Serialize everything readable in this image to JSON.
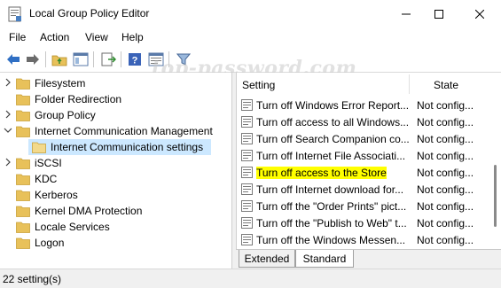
{
  "window": {
    "title": "Local Group Policy Editor",
    "icon": "policy-editor-icon",
    "controls": [
      "minimize",
      "maximize",
      "close"
    ]
  },
  "menu": [
    "File",
    "Action",
    "View",
    "Help"
  ],
  "toolbar": {
    "buttons": [
      "back-icon",
      "forward-icon",
      "up-folder-icon",
      "show-hide-tree-icon",
      "export-list-icon",
      "help-icon",
      "properties-icon",
      "filter-icon"
    ]
  },
  "tree": {
    "items": [
      {
        "label": "Filesystem",
        "expander": "collapsed"
      },
      {
        "label": "Folder Redirection",
        "expander": "none"
      },
      {
        "label": "Group Policy",
        "expander": "collapsed"
      },
      {
        "label": "Internet Communication Management",
        "expander": "expanded"
      },
      {
        "label": "Internet Communication settings",
        "expander": "none",
        "selected": true
      },
      {
        "label": "iSCSI",
        "expander": "collapsed"
      },
      {
        "label": "KDC",
        "expander": "none"
      },
      {
        "label": "Kerberos",
        "expander": "none"
      },
      {
        "label": "Kernel DMA Protection",
        "expander": "none"
      },
      {
        "label": "Locale Services",
        "expander": "none"
      },
      {
        "label": "Logon",
        "expander": "none"
      }
    ]
  },
  "list": {
    "headers": {
      "setting": "Setting",
      "state": "State"
    },
    "rows": [
      {
        "setting": "Turn off Windows Error Report...",
        "state": "Not config..."
      },
      {
        "setting": "Turn off access to all Windows...",
        "state": "Not config..."
      },
      {
        "setting": "Turn off Search Companion co...",
        "state": "Not config..."
      },
      {
        "setting": "Turn off Internet File Associati...",
        "state": "Not config..."
      },
      {
        "setting": "Turn off access to the Store",
        "state": "Not config...",
        "highlighted": true
      },
      {
        "setting": "Turn off Internet download for...",
        "state": "Not config..."
      },
      {
        "setting": "Turn off the \"Order Prints\" pict...",
        "state": "Not config..."
      },
      {
        "setting": "Turn off the \"Publish to Web\" t...",
        "state": "Not config..."
      },
      {
        "setting": "Turn off the Windows Messen...",
        "state": "Not config..."
      }
    ]
  },
  "tabs": {
    "extended": "Extended",
    "standard": "Standard",
    "active": "Standard"
  },
  "status": {
    "text": "22 setting(s)"
  },
  "watermark": "top-password.com",
  "colors": {
    "highlight": "#ffff00",
    "selected_bg": "#cce8ff",
    "folder": "#e8c15a"
  }
}
